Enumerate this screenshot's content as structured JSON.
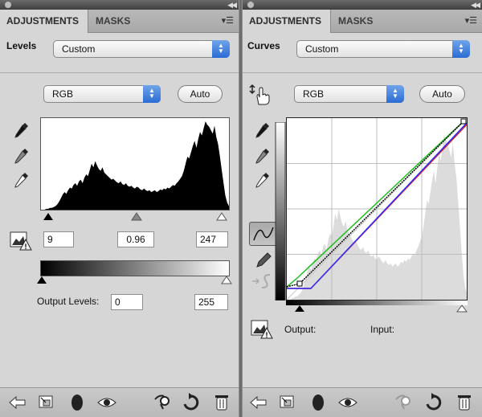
{
  "left_panel": {
    "tabs": [
      {
        "label": "ADJUSTMENTS"
      },
      {
        "label": "MASKS"
      }
    ],
    "adjustment_label": "Levels",
    "preset": "Custom",
    "channel": "RGB",
    "auto_label": "Auto",
    "input_black": "9",
    "input_gamma": "0.96",
    "input_white": "247",
    "output_label": "Output Levels:",
    "output_black": "0",
    "output_white": "255"
  },
  "right_panel": {
    "tabs": [
      {
        "label": "ADJUSTMENTS"
      },
      {
        "label": "MASKS"
      }
    ],
    "adjustment_label": "Curves",
    "preset": "Custom",
    "channel": "RGB",
    "auto_label": "Auto",
    "output_label": "Output:",
    "input_label": "Input:"
  },
  "histogram": {
    "levels": [
      0,
      0,
      0,
      1,
      1,
      2,
      2,
      3,
      4,
      6,
      9,
      13,
      17,
      20,
      18,
      22,
      25,
      24,
      28,
      30,
      27,
      32,
      34,
      30,
      36,
      40,
      38,
      45,
      52,
      48,
      55,
      50,
      46,
      44,
      48,
      42,
      40,
      38,
      36,
      34,
      35,
      33,
      31,
      30,
      32,
      29,
      28,
      30,
      27,
      26,
      27,
      25,
      24,
      26,
      25,
      23,
      22,
      24,
      22,
      21,
      22,
      20,
      21,
      22,
      20,
      21,
      23,
      22,
      24,
      23,
      25,
      24,
      26,
      28,
      27,
      30,
      32,
      35,
      38,
      44,
      52,
      60,
      58,
      65,
      72,
      78,
      70,
      80,
      88,
      84,
      92,
      100,
      96,
      94,
      90,
      86,
      95,
      82,
      74,
      60,
      45,
      30,
      16,
      8,
      4
    ]
  },
  "colors": {
    "panel_bg": "#d6d6d6",
    "tab_bar": "#b1b1b1",
    "select_arrow": "#3b79dc",
    "curve_black": "#000000",
    "curve_green": "#1fbf1f",
    "curve_blue": "#2c2cff",
    "curve_red": "#e01b1b"
  },
  "icons": {
    "black_point_eyedropper": "eyedropper-black-icon",
    "gray_point_eyedropper": "eyedropper-gray-icon",
    "white_point_eyedropper": "eyedropper-white-icon",
    "clipping_warning": "clipping-warning-icon",
    "targeted_adjust": "targeted-adjust-hand-icon",
    "curve_point_mode": "curve-point-icon",
    "pencil_mode": "pencil-icon",
    "smooth": "smooth-curve-icon",
    "back": "back-arrow-icon",
    "expand": "expand-view-icon",
    "clip_layer": "clip-to-layer-icon",
    "visibility": "eye-icon",
    "previous_state": "previous-state-icon",
    "reset": "reset-icon",
    "delete": "trash-icon"
  }
}
